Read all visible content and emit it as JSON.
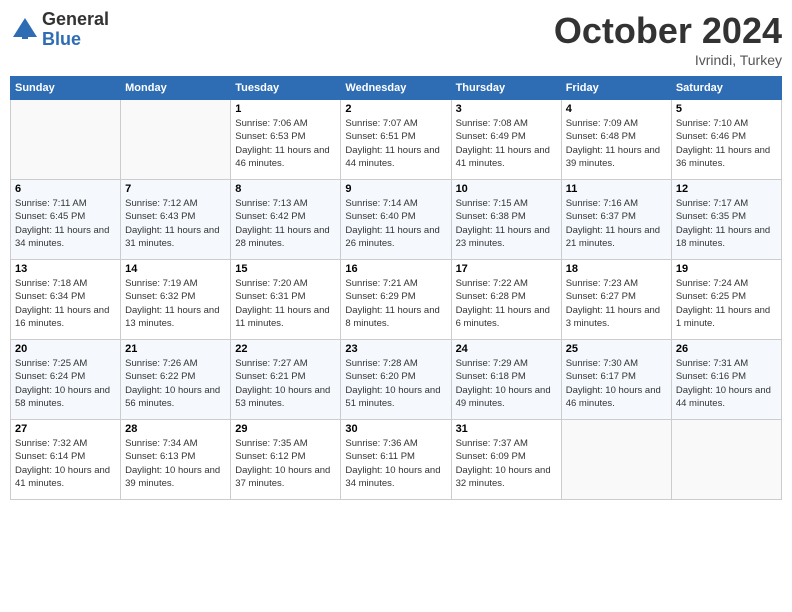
{
  "logo": {
    "general": "General",
    "blue": "Blue"
  },
  "header": {
    "month": "October 2024",
    "location": "Ivrindi, Turkey"
  },
  "weekdays": [
    "Sunday",
    "Monday",
    "Tuesday",
    "Wednesday",
    "Thursday",
    "Friday",
    "Saturday"
  ],
  "weeks": [
    [
      {
        "day": "",
        "sunrise": "",
        "sunset": "",
        "daylight": ""
      },
      {
        "day": "",
        "sunrise": "",
        "sunset": "",
        "daylight": ""
      },
      {
        "day": "1",
        "sunrise": "Sunrise: 7:06 AM",
        "sunset": "Sunset: 6:53 PM",
        "daylight": "Daylight: 11 hours and 46 minutes."
      },
      {
        "day": "2",
        "sunrise": "Sunrise: 7:07 AM",
        "sunset": "Sunset: 6:51 PM",
        "daylight": "Daylight: 11 hours and 44 minutes."
      },
      {
        "day": "3",
        "sunrise": "Sunrise: 7:08 AM",
        "sunset": "Sunset: 6:49 PM",
        "daylight": "Daylight: 11 hours and 41 minutes."
      },
      {
        "day": "4",
        "sunrise": "Sunrise: 7:09 AM",
        "sunset": "Sunset: 6:48 PM",
        "daylight": "Daylight: 11 hours and 39 minutes."
      },
      {
        "day": "5",
        "sunrise": "Sunrise: 7:10 AM",
        "sunset": "Sunset: 6:46 PM",
        "daylight": "Daylight: 11 hours and 36 minutes."
      }
    ],
    [
      {
        "day": "6",
        "sunrise": "Sunrise: 7:11 AM",
        "sunset": "Sunset: 6:45 PM",
        "daylight": "Daylight: 11 hours and 34 minutes."
      },
      {
        "day": "7",
        "sunrise": "Sunrise: 7:12 AM",
        "sunset": "Sunset: 6:43 PM",
        "daylight": "Daylight: 11 hours and 31 minutes."
      },
      {
        "day": "8",
        "sunrise": "Sunrise: 7:13 AM",
        "sunset": "Sunset: 6:42 PM",
        "daylight": "Daylight: 11 hours and 28 minutes."
      },
      {
        "day": "9",
        "sunrise": "Sunrise: 7:14 AM",
        "sunset": "Sunset: 6:40 PM",
        "daylight": "Daylight: 11 hours and 26 minutes."
      },
      {
        "day": "10",
        "sunrise": "Sunrise: 7:15 AM",
        "sunset": "Sunset: 6:38 PM",
        "daylight": "Daylight: 11 hours and 23 minutes."
      },
      {
        "day": "11",
        "sunrise": "Sunrise: 7:16 AM",
        "sunset": "Sunset: 6:37 PM",
        "daylight": "Daylight: 11 hours and 21 minutes."
      },
      {
        "day": "12",
        "sunrise": "Sunrise: 7:17 AM",
        "sunset": "Sunset: 6:35 PM",
        "daylight": "Daylight: 11 hours and 18 minutes."
      }
    ],
    [
      {
        "day": "13",
        "sunrise": "Sunrise: 7:18 AM",
        "sunset": "Sunset: 6:34 PM",
        "daylight": "Daylight: 11 hours and 16 minutes."
      },
      {
        "day": "14",
        "sunrise": "Sunrise: 7:19 AM",
        "sunset": "Sunset: 6:32 PM",
        "daylight": "Daylight: 11 hours and 13 minutes."
      },
      {
        "day": "15",
        "sunrise": "Sunrise: 7:20 AM",
        "sunset": "Sunset: 6:31 PM",
        "daylight": "Daylight: 11 hours and 11 minutes."
      },
      {
        "day": "16",
        "sunrise": "Sunrise: 7:21 AM",
        "sunset": "Sunset: 6:29 PM",
        "daylight": "Daylight: 11 hours and 8 minutes."
      },
      {
        "day": "17",
        "sunrise": "Sunrise: 7:22 AM",
        "sunset": "Sunset: 6:28 PM",
        "daylight": "Daylight: 11 hours and 6 minutes."
      },
      {
        "day": "18",
        "sunrise": "Sunrise: 7:23 AM",
        "sunset": "Sunset: 6:27 PM",
        "daylight": "Daylight: 11 hours and 3 minutes."
      },
      {
        "day": "19",
        "sunrise": "Sunrise: 7:24 AM",
        "sunset": "Sunset: 6:25 PM",
        "daylight": "Daylight: 11 hours and 1 minute."
      }
    ],
    [
      {
        "day": "20",
        "sunrise": "Sunrise: 7:25 AM",
        "sunset": "Sunset: 6:24 PM",
        "daylight": "Daylight: 10 hours and 58 minutes."
      },
      {
        "day": "21",
        "sunrise": "Sunrise: 7:26 AM",
        "sunset": "Sunset: 6:22 PM",
        "daylight": "Daylight: 10 hours and 56 minutes."
      },
      {
        "day": "22",
        "sunrise": "Sunrise: 7:27 AM",
        "sunset": "Sunset: 6:21 PM",
        "daylight": "Daylight: 10 hours and 53 minutes."
      },
      {
        "day": "23",
        "sunrise": "Sunrise: 7:28 AM",
        "sunset": "Sunset: 6:20 PM",
        "daylight": "Daylight: 10 hours and 51 minutes."
      },
      {
        "day": "24",
        "sunrise": "Sunrise: 7:29 AM",
        "sunset": "Sunset: 6:18 PM",
        "daylight": "Daylight: 10 hours and 49 minutes."
      },
      {
        "day": "25",
        "sunrise": "Sunrise: 7:30 AM",
        "sunset": "Sunset: 6:17 PM",
        "daylight": "Daylight: 10 hours and 46 minutes."
      },
      {
        "day": "26",
        "sunrise": "Sunrise: 7:31 AM",
        "sunset": "Sunset: 6:16 PM",
        "daylight": "Daylight: 10 hours and 44 minutes."
      }
    ],
    [
      {
        "day": "27",
        "sunrise": "Sunrise: 7:32 AM",
        "sunset": "Sunset: 6:14 PM",
        "daylight": "Daylight: 10 hours and 41 minutes."
      },
      {
        "day": "28",
        "sunrise": "Sunrise: 7:34 AM",
        "sunset": "Sunset: 6:13 PM",
        "daylight": "Daylight: 10 hours and 39 minutes."
      },
      {
        "day": "29",
        "sunrise": "Sunrise: 7:35 AM",
        "sunset": "Sunset: 6:12 PM",
        "daylight": "Daylight: 10 hours and 37 minutes."
      },
      {
        "day": "30",
        "sunrise": "Sunrise: 7:36 AM",
        "sunset": "Sunset: 6:11 PM",
        "daylight": "Daylight: 10 hours and 34 minutes."
      },
      {
        "day": "31",
        "sunrise": "Sunrise: 7:37 AM",
        "sunset": "Sunset: 6:09 PM",
        "daylight": "Daylight: 10 hours and 32 minutes."
      },
      {
        "day": "",
        "sunrise": "",
        "sunset": "",
        "daylight": ""
      },
      {
        "day": "",
        "sunrise": "",
        "sunset": "",
        "daylight": ""
      }
    ]
  ]
}
